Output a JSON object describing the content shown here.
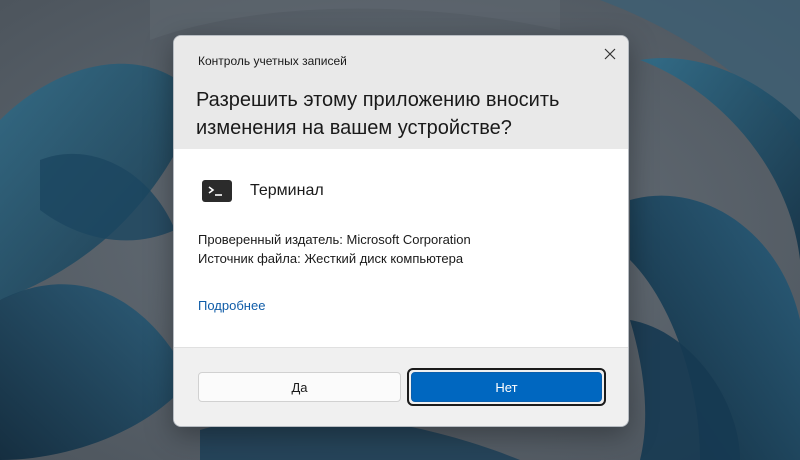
{
  "dialog": {
    "caption": "Контроль учетных записей",
    "question": "Разрешить этому приложению вносить изменения на вашем устройстве?",
    "close_icon": "close-icon"
  },
  "app": {
    "icon": "terminal-icon",
    "name": "Терминал"
  },
  "info": {
    "publisher": "Проверенный издатель: Microsoft Corporation",
    "source": "Источник файла: Жесткий диск компьютера"
  },
  "details_link": "Подробнее",
  "buttons": {
    "yes": "Да",
    "no": "Нет"
  },
  "colors": {
    "accent": "#0067c0",
    "link": "#0f5ca8",
    "header_bg": "#e9e9e9",
    "footer_bg": "#f0f0f0"
  }
}
